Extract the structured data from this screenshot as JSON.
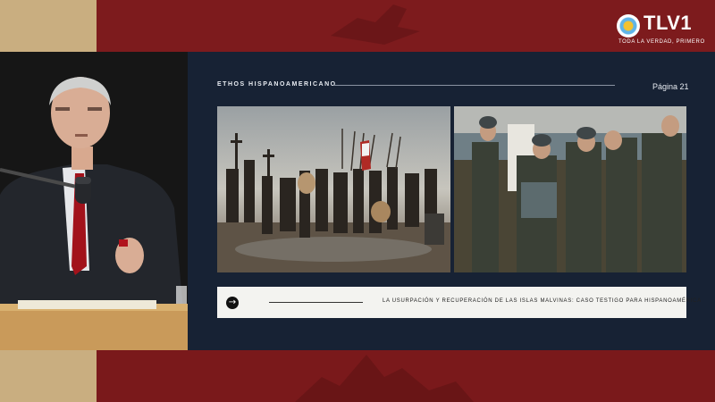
{
  "channel": {
    "logo_text": "TLV1",
    "tagline": "TODA LA VERDAD, PRIMERO",
    "brand_color": "#7d1b1d",
    "accent_color": "#c9ae80"
  },
  "slide": {
    "heading": "ETHOS HISPANOAMERICANO",
    "page_label": "Página 21",
    "images": [
      {
        "name": "historical-painting-soldiers-with-flags"
      },
      {
        "name": "photo-soldiers-group"
      }
    ],
    "caption": "LA USURPACIÓN Y RECUPERACIÓN DE LAS ISLAS MALVINAS: CASO TESTIGO PARA HISPANOAMÉRICA",
    "caption_icon": "arrow-right-icon"
  },
  "speaker_feed": {
    "description_icon": "speaker-at-podium"
  }
}
